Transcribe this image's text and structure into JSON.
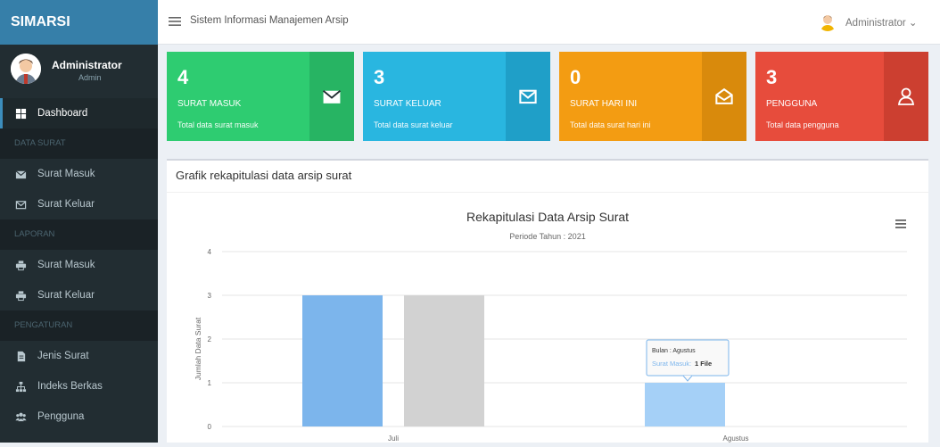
{
  "app": {
    "brand": "SIMARSI",
    "topbar_title": "Sistem Informasi Manajemen Arsip",
    "topbar_user": "Administrator ⌄"
  },
  "sidebar": {
    "user_name": "Administrator",
    "user_role": "Admin",
    "items": [
      {
        "type": "item",
        "label": "Dashboard",
        "icon": "dashboard-icon",
        "active": true
      },
      {
        "type": "header",
        "label": "DATA SURAT"
      },
      {
        "type": "item",
        "label": "Surat Masuk",
        "icon": "envelope-icon"
      },
      {
        "type": "item",
        "label": "Surat Keluar",
        "icon": "envelope-outline-icon"
      },
      {
        "type": "header",
        "label": "LAPORAN"
      },
      {
        "type": "item",
        "label": "Surat Masuk",
        "icon": "print-icon"
      },
      {
        "type": "item",
        "label": "Surat Keluar",
        "icon": "print-icon"
      },
      {
        "type": "header",
        "label": "PENGATURAN"
      },
      {
        "type": "item",
        "label": "Jenis Surat",
        "icon": "file-icon"
      },
      {
        "type": "item",
        "label": "Indeks Berkas",
        "icon": "sitemap-icon"
      },
      {
        "type": "item",
        "label": "Pengguna",
        "icon": "users-icon"
      }
    ]
  },
  "info_boxes": [
    {
      "number": "4",
      "title": "SURAT MASUK",
      "desc": "Total data surat masuk",
      "color": "#2ecc71",
      "icon_bg": "#27b463",
      "icon": "envelope-icon"
    },
    {
      "number": "3",
      "title": "SURAT KELUAR",
      "desc": "Total data surat keluar",
      "color": "#29b6e0",
      "icon_bg": "#1f9fc8",
      "icon": "envelope-outline-icon"
    },
    {
      "number": "0",
      "title": "SURAT HARI INI",
      "desc": "Total data surat hari ini",
      "color": "#f39c12",
      "icon_bg": "#d98a0c",
      "icon": "envelope-open-icon"
    },
    {
      "number": "3",
      "title": "PENGGUNA",
      "desc": "Total data pengguna",
      "color": "#e74c3c",
      "icon_bg": "#cc3f30",
      "icon": "user-icon"
    }
  ],
  "chart_box": {
    "heading": "Grafik rekapitulasi data arsip surat"
  },
  "chart_data": {
    "type": "bar",
    "title": "Rekapitulasi Data Arsip Surat",
    "subtitle": "Periode Tahun : 2021",
    "ylabel": "Jumlah Data Surat",
    "xlabel": "",
    "ylim": [
      0,
      4
    ],
    "yticks": [
      0,
      1,
      2,
      3,
      4
    ],
    "categories": [
      "Juli",
      "Agustus"
    ],
    "series": [
      {
        "values": [
          3,
          1
        ],
        "color": "#7cb5ec"
      },
      {
        "values": [
          3,
          0
        ],
        "color": "#d2d2d2"
      }
    ],
    "tooltip": {
      "category_line": "Bulan : Agustus",
      "series_label": "Surat Masuk:",
      "value_text": "1 File"
    },
    "grid": true
  }
}
